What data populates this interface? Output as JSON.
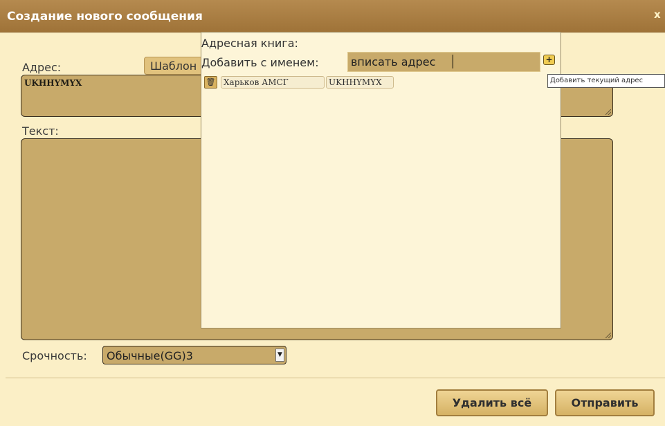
{
  "window": {
    "title": "Создание нового сообщения",
    "close_glyph": "x"
  },
  "form": {
    "address_label": "Адрес:",
    "template_button_label": "Шаблон",
    "address_value": "UKHHYMYX",
    "text_label": "Текст:",
    "text_value": "",
    "urgency_label": "Срочность:",
    "urgency_selected": "Обычные(GG)3"
  },
  "buttons": {
    "delete_all": "Удалить всё",
    "send": "Отправить"
  },
  "address_book": {
    "title": "Адресная книга:",
    "add_label": "Добавить с именем:",
    "name_input_value": "вписать адрес",
    "add_button_glyph": "+",
    "add_tooltip": "Добавить текущий адрес",
    "entries": [
      {
        "name": "Харьков АМСГ",
        "address": "UKHHYMYX"
      }
    ]
  }
}
